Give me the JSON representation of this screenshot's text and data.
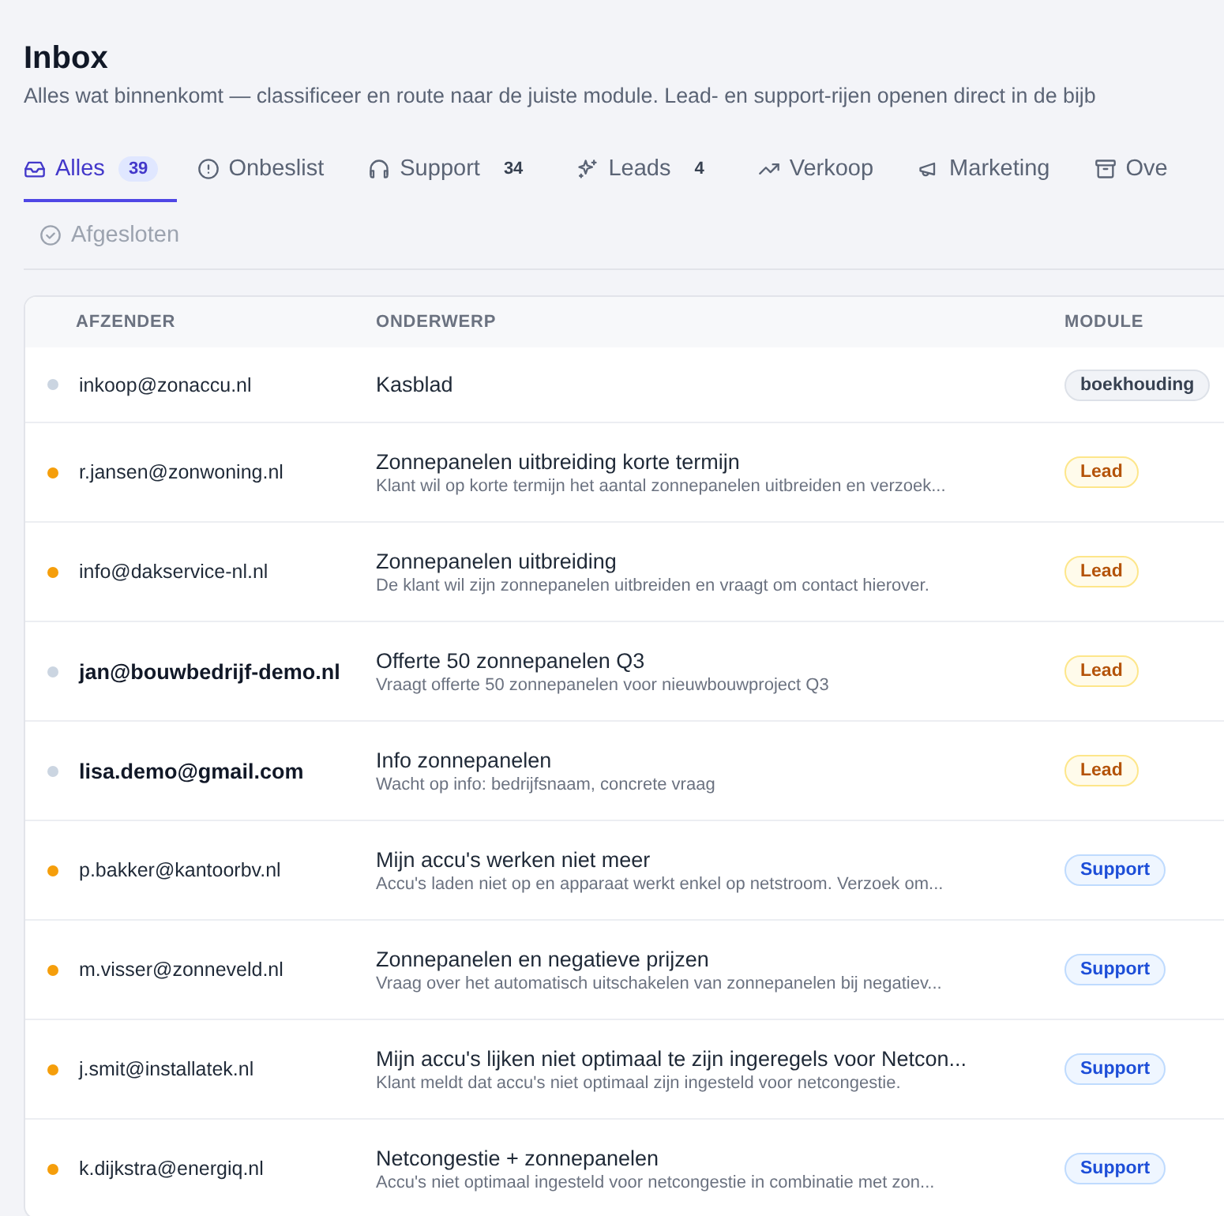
{
  "header": {
    "title": "Inbox",
    "subtitle": "Alles wat binnenkomt — classificeer en route naar de juiste module. Lead- en support-rijen openen direct in de bijb"
  },
  "tab_rows": [
    [
      {
        "kind": "inbox",
        "label": "Alles",
        "count": "39",
        "selected": true,
        "disabled": false
      },
      {
        "kind": "alert",
        "label": "Onbeslist",
        "selected": false,
        "disabled": false
      },
      {
        "kind": "headphones",
        "label": "Support",
        "count": "34",
        "selected": false,
        "disabled": false
      },
      {
        "kind": "sparkles",
        "label": "Leads",
        "count": "4",
        "selected": false,
        "disabled": false
      },
      {
        "kind": "trend",
        "label": "Verkoop",
        "selected": false,
        "disabled": false
      },
      {
        "kind": "megaphone",
        "label": "Marketing",
        "selected": false,
        "disabled": false
      },
      {
        "kind": "archive",
        "label": "Ove",
        "selected": false,
        "disabled": false
      }
    ],
    [
      {
        "kind": "check",
        "label": "Afgesloten",
        "selected": false,
        "disabled": true
      }
    ]
  ],
  "table": {
    "columns": [
      "AFZENDER",
      "ONDERWERP",
      "MODULE"
    ],
    "rows": [
      {
        "color": "#cbd5e1",
        "sender": "inkoop@zonaccu.nl",
        "unread": false,
        "subject": "Kasblad",
        "module": {
          "kind": "neutral",
          "label": "boekhouding"
        }
      },
      {
        "color": "#f59e0b",
        "sender": "r.jansen@zonwoning.nl",
        "unread": false,
        "subject": "Zonnepanelen uitbreiding korte termijn",
        "summary": "Klant wil op korte termijn het aantal zonnepanelen uitbreiden en verzoek...",
        "module": {
          "kind": "lead",
          "label": "Lead"
        }
      },
      {
        "color": "#f59e0b",
        "sender": "info@dakservice-nl.nl",
        "unread": false,
        "subject": "Zonnepanelen uitbreiding",
        "summary": "De klant wil zijn zonnepanelen uitbreiden en vraagt om contact hierover.",
        "module": {
          "kind": "lead",
          "label": "Lead"
        }
      },
      {
        "color": "#cbd5e1",
        "sender": "jan@bouwbedrijf-demo.nl",
        "unread": true,
        "subject": "Offerte 50 zonnepanelen Q3",
        "summary": "Vraagt offerte 50 zonnepanelen voor nieuwbouwproject Q3",
        "module": {
          "kind": "lead",
          "label": "Lead"
        }
      },
      {
        "color": "#cbd5e1",
        "sender": "lisa.demo@gmail.com",
        "unread": true,
        "subject": "Info zonnepanelen",
        "summary": "Wacht op info: bedrijfsnaam, concrete vraag",
        "module": {
          "kind": "lead",
          "label": "Lead"
        }
      },
      {
        "color": "#f59e0b",
        "sender": "p.bakker@kantoorbv.nl",
        "unread": false,
        "subject": "Mijn accu's werken niet meer",
        "summary": "Accu's laden niet op en apparaat werkt enkel op netstroom. Verzoek om...",
        "module": {
          "kind": "support",
          "label": "Support"
        }
      },
      {
        "color": "#f59e0b",
        "sender": "m.visser@zonneveld.nl",
        "unread": false,
        "subject": "Zonnepanelen en negatieve prijzen",
        "summary": "Vraag over het automatisch uitschakelen van zonnepanelen bij negatiev...",
        "module": {
          "kind": "support",
          "label": "Support"
        }
      },
      {
        "color": "#f59e0b",
        "sender": "j.smit@installatek.nl",
        "unread": false,
        "subject": "Mijn accu's lijken niet optimaal te zijn ingeregels voor Netcon...",
        "summary": "Klant meldt dat accu's niet optimaal zijn ingesteld voor netcongestie.",
        "module": {
          "kind": "support",
          "label": "Support"
        }
      },
      {
        "color": "#f59e0b",
        "sender": "k.dijkstra@energiq.nl",
        "unread": false,
        "subject": "Netcongestie + zonnepanelen",
        "summary": "Accu's niet optimaal ingesteld voor netcongestie in combinatie met zon...",
        "module": {
          "kind": "support",
          "label": "Support"
        }
      }
    ]
  }
}
